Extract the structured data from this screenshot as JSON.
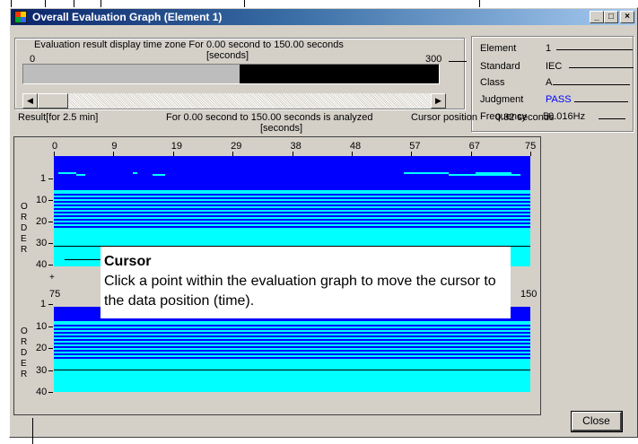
{
  "window": {
    "title": "Overall Evaluation Graph (Element 1)",
    "minimize": "_",
    "maximize": "□",
    "close": "×"
  },
  "display_zone": {
    "label": "Evaluation result display time zone  For   0.00 second to 150.00 seconds",
    "unit": "[seconds]",
    "start": "0",
    "end": "300",
    "highlight_fraction": 0.5
  },
  "result_line": {
    "label": "Result[for 2.5 min]",
    "analyzed": "For  0.00 second to 150.00 seconds is analyzed",
    "unit": "[seconds]",
    "cursor_label": "Cursor position",
    "cursor_value": "0.32 seconds"
  },
  "info": {
    "element_label": "Element",
    "element_value": "1",
    "standard_label": "Standard",
    "standard_value": "IEC",
    "class_label": "Class",
    "class_value": "A",
    "judgment_label": "Judgment",
    "judgment_value": "PASS",
    "frequency_label": "Frequency",
    "frequency_value": "50.016Hz"
  },
  "graph_top": {
    "x_ticks": [
      "0",
      "9",
      "19",
      "29",
      "38",
      "48",
      "57",
      "67",
      "75"
    ],
    "y_ticks": [
      "1",
      "10",
      "20",
      "30",
      "40"
    ],
    "order_letters": [
      "O",
      "R",
      "D",
      "E",
      "R"
    ],
    "marker": "+"
  },
  "graph_bottom": {
    "x_ticks": [
      "75",
      "150"
    ],
    "y_ticks": [
      "1",
      "10",
      "20",
      "30",
      "40"
    ],
    "order_letters": [
      "O",
      "R",
      "D",
      "E",
      "R"
    ]
  },
  "tooltip": {
    "title": "Cursor",
    "body": "Click a point within the evaluation graph to move the cursor to the data position (time)."
  },
  "buttons": {
    "close": "Close"
  },
  "colors": {
    "graph_dark": "#0000ff",
    "graph_light": "#00ffff",
    "pass": "#0000ff"
  },
  "icons": [
    "app-icon",
    "scroll-left-icon",
    "scroll-right-icon"
  ]
}
